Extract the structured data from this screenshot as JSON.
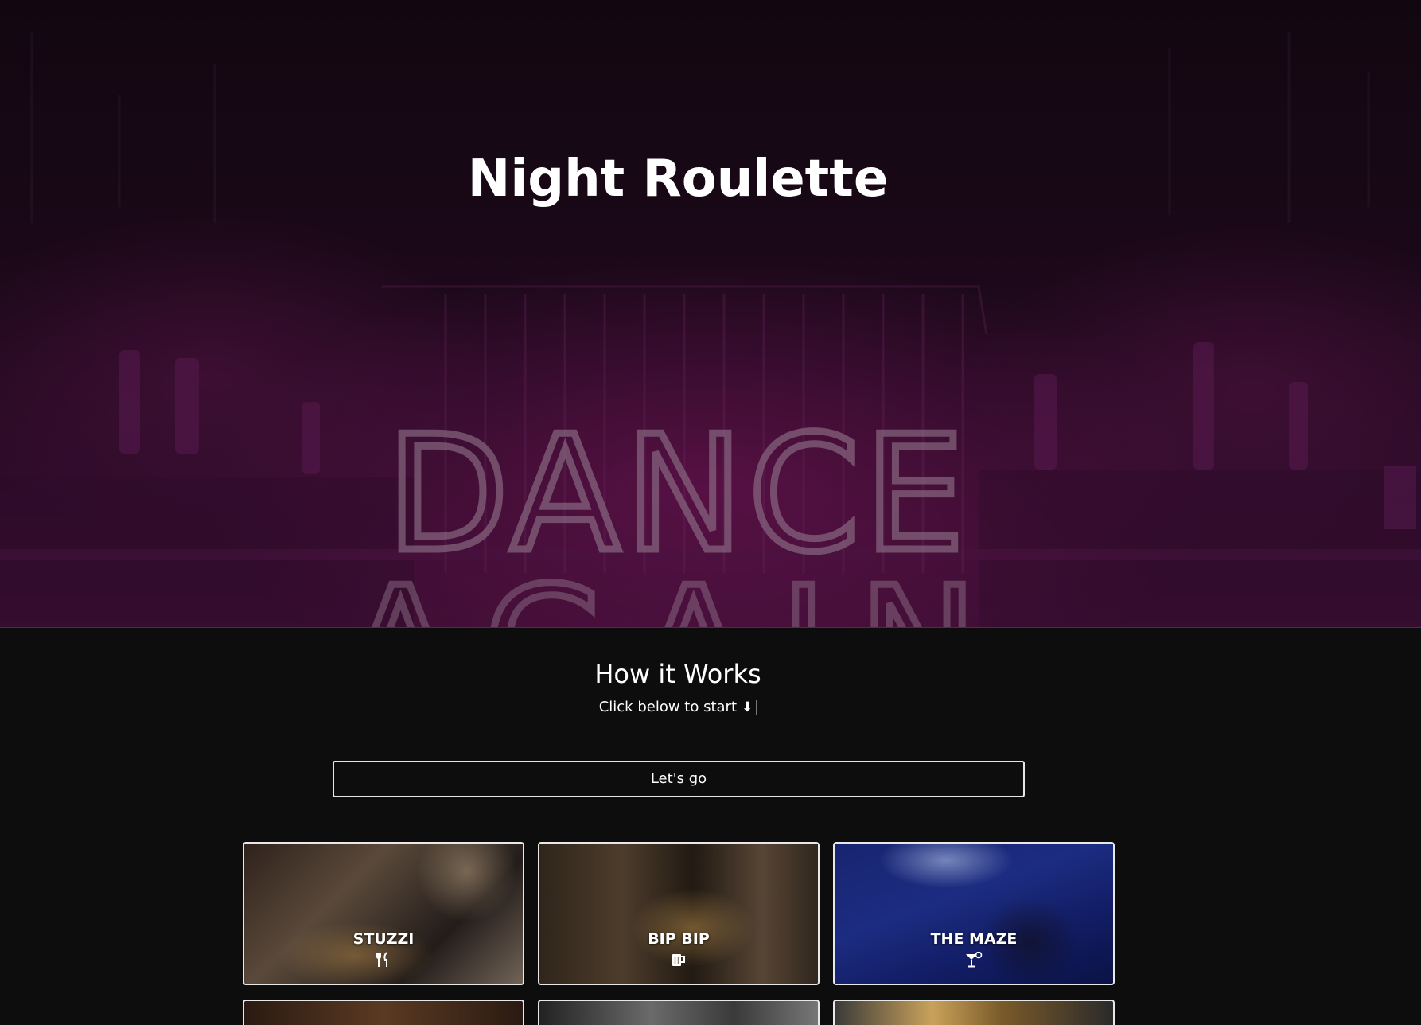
{
  "hero": {
    "title": "Night Roulette",
    "background_sign": "DANCE AGAIN"
  },
  "how_it_works": {
    "title": "How it Works",
    "subtitle": "Click below to start"
  },
  "cta": {
    "label": "Let's go"
  },
  "cards": [
    {
      "name": "STUZZI",
      "icon": "utensils-icon"
    },
    {
      "name": "BIP BIP",
      "icon": "beer-mug-icon"
    },
    {
      "name": "THE MAZE",
      "icon": "cocktail-icon"
    }
  ],
  "colors": {
    "background": "#0d0d0e",
    "text": "#ffffff",
    "button_border": "#e6e6e6",
    "neon_accent": "#7a1f6a"
  }
}
